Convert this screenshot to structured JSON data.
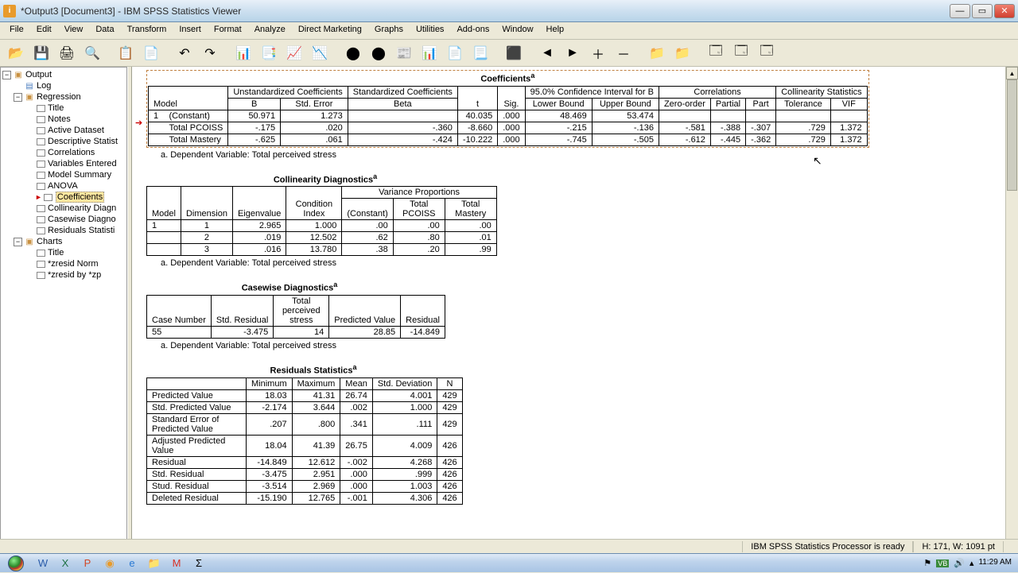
{
  "window": {
    "title": "*Output3 [Document3] - IBM SPSS Statistics Viewer"
  },
  "menu": [
    "File",
    "Edit",
    "View",
    "Data",
    "Transform",
    "Insert",
    "Format",
    "Analyze",
    "Direct Marketing",
    "Graphs",
    "Utilities",
    "Add-ons",
    "Window",
    "Help"
  ],
  "outline": {
    "root": "Output",
    "log": "Log",
    "reg": "Regression",
    "items": [
      "Title",
      "Notes",
      "Active Dataset",
      "Descriptive Statist",
      "Correlations",
      "Variables Entered",
      "Model Summary",
      "ANOVA",
      "Coefficients",
      "Collinearity Diagn",
      "Casewise Diagno",
      "Residuals Statisti"
    ],
    "charts": "Charts",
    "chartItems": [
      "Title",
      "*zresid Norm",
      "*zresid by *zp"
    ]
  },
  "coef": {
    "title": "Coefficients",
    "headers": {
      "model": "Model",
      "unstd": "Unstandardized Coefficients",
      "std": "Standardized Coefficients",
      "b": "B",
      "se": "Std. Error",
      "beta": "Beta",
      "t": "t",
      "sig": "Sig.",
      "ci": "95.0% Confidence Interval for B",
      "lb": "Lower Bound",
      "ub": "Upper Bound",
      "corr": "Correlations",
      "zo": "Zero-order",
      "partial": "Partial",
      "part": "Part",
      "col": "Collinearity Statistics",
      "tol": "Tolerance",
      "vif": "VIF"
    },
    "rows": [
      {
        "m": "1",
        "name": "(Constant)",
        "b": "50.971",
        "se": "1.273",
        "beta": "",
        "t": "40.035",
        "sig": ".000",
        "lb": "48.469",
        "ub": "53.474",
        "zo": "",
        "pa": "",
        "pr": "",
        "tol": "",
        "vif": ""
      },
      {
        "m": "",
        "name": "Total PCOISS",
        "b": "-.175",
        "se": ".020",
        "beta": "-.360",
        "t": "-8.660",
        "sig": ".000",
        "lb": "-.215",
        "ub": "-.136",
        "zo": "-.581",
        "pa": "-.388",
        "pr": "-.307",
        "tol": ".729",
        "vif": "1.372"
      },
      {
        "m": "",
        "name": "Total Mastery",
        "b": "-.625",
        "se": ".061",
        "beta": "-.424",
        "t": "-10.222",
        "sig": ".000",
        "lb": "-.745",
        "ub": "-.505",
        "zo": "-.612",
        "pa": "-.445",
        "pr": "-.362",
        "tol": ".729",
        "vif": "1.372"
      }
    ],
    "foot": "a. Dependent Variable: Total perceived stress"
  },
  "colldiag": {
    "title": "Collinearity Diagnostics",
    "h": {
      "model": "Model",
      "dim": "Dimension",
      "eig": "Eigenvalue",
      "ci": "Condition Index",
      "vp": "Variance Proportions",
      "c": "(Constant)",
      "p": "Total PCOISS",
      "m": "Total Mastery"
    },
    "rows": [
      {
        "m": "1",
        "d": "1",
        "e": "2.965",
        "ci": "1.000",
        "c": ".00",
        "p": ".00",
        "t": ".00"
      },
      {
        "m": "",
        "d": "2",
        "e": ".019",
        "ci": "12.502",
        "c": ".62",
        "p": ".80",
        "t": ".01"
      },
      {
        "m": "",
        "d": "3",
        "e": ".016",
        "ci": "13.780",
        "c": ".38",
        "p": ".20",
        "t": ".99"
      }
    ],
    "foot": "a. Dependent Variable: Total perceived stress"
  },
  "casewise": {
    "title": "Casewise Diagnostics",
    "h": {
      "cn": "Case Number",
      "sr": "Std. Residual",
      "tps": "Total perceived stress",
      "pv": "Predicted Value",
      "r": "Residual"
    },
    "rows": [
      {
        "cn": "55",
        "sr": "-3.475",
        "tps": "14",
        "pv": "28.85",
        "r": "-14.849"
      }
    ],
    "foot": "a. Dependent Variable: Total perceived stress"
  },
  "resid": {
    "title": "Residuals Statistics",
    "h": {
      "min": "Minimum",
      "max": "Maximum",
      "mean": "Mean",
      "sd": "Std. Deviation",
      "n": "N"
    },
    "rows": [
      {
        "l": "Predicted Value",
        "min": "18.03",
        "max": "41.31",
        "mean": "26.74",
        "sd": "4.001",
        "n": "429"
      },
      {
        "l": "Std. Predicted Value",
        "min": "-2.174",
        "max": "3.644",
        "mean": ".002",
        "sd": "1.000",
        "n": "429"
      },
      {
        "l": "Standard Error of Predicted Value",
        "min": ".207",
        "max": ".800",
        "mean": ".341",
        "sd": ".111",
        "n": "429"
      },
      {
        "l": "Adjusted Predicted Value",
        "min": "18.04",
        "max": "41.39",
        "mean": "26.75",
        "sd": "4.009",
        "n": "426"
      },
      {
        "l": "Residual",
        "min": "-14.849",
        "max": "12.612",
        "mean": "-.002",
        "sd": "4.268",
        "n": "426"
      },
      {
        "l": "Std. Residual",
        "min": "-3.475",
        "max": "2.951",
        "mean": ".000",
        "sd": ".999",
        "n": "426"
      },
      {
        "l": "Stud. Residual",
        "min": "-3.514",
        "max": "2.969",
        "mean": ".000",
        "sd": "1.003",
        "n": "426"
      },
      {
        "l": "Deleted Residual",
        "min": "-15.190",
        "max": "12.765",
        "mean": "-.001",
        "sd": "4.306",
        "n": "426"
      }
    ]
  },
  "status": {
    "proc": "IBM SPSS Statistics Processor is ready",
    "pos": "H: 171, W: 1091 pt"
  },
  "tray": {
    "time": "11:29 AM"
  }
}
